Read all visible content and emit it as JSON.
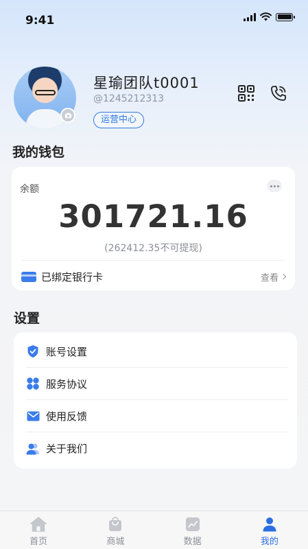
{
  "status_bar": {
    "time": "9:41"
  },
  "profile": {
    "name": "星瑜团队t0001",
    "uid": "@1245212313",
    "role_badge": "运营中心"
  },
  "wallet": {
    "section_title": "我的钱包",
    "balance_label": "余额",
    "balance": "301721.16",
    "withdraw_note": "(262412.35不可提现)",
    "bank_label": "已绑定银行卡",
    "view_label": "查看"
  },
  "settings": {
    "section_title": "设置",
    "items": [
      {
        "label": "账号设置",
        "icon": "shield-check-icon"
      },
      {
        "label": "服务协议",
        "icon": "four-petal-icon"
      },
      {
        "label": "使用反馈",
        "icon": "mail-icon"
      },
      {
        "label": "关于我们",
        "icon": "users-icon"
      }
    ]
  },
  "tabbar": {
    "tabs": [
      {
        "label": "首页",
        "icon": "home-icon",
        "active": false
      },
      {
        "label": "商城",
        "icon": "shopping-bag-icon",
        "active": false
      },
      {
        "label": "数据",
        "icon": "chart-icon",
        "active": false
      },
      {
        "label": "我的",
        "icon": "user-icon",
        "active": true
      }
    ]
  },
  "colors": {
    "accent": "#2d6fe0",
    "icon_blue": "#3a7cea",
    "inactive": "#c4c7cc"
  }
}
